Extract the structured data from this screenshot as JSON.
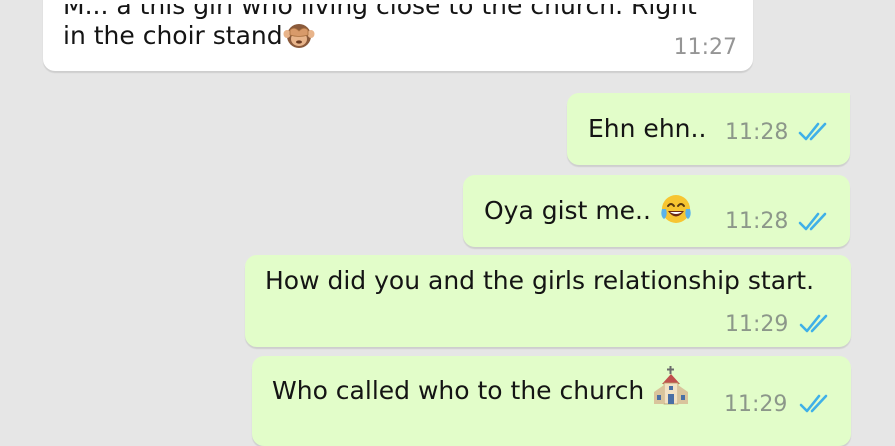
{
  "chat": {
    "messages": [
      {
        "direction": "incoming",
        "lines": [
          "M... a this girl who living close to the church. Right",
          "in the choir stand"
        ],
        "emoji": "see-no-evil-monkey",
        "time": "11:27"
      },
      {
        "direction": "outgoing",
        "text": "Ehn ehn..",
        "time": "11:28",
        "status": "read"
      },
      {
        "direction": "outgoing",
        "text": "Oya gist me..",
        "emoji": "face-with-tears-of-joy",
        "time": "11:28",
        "status": "read"
      },
      {
        "direction": "outgoing",
        "text": "How did you and the girls relationship start.",
        "time": "11:29",
        "status": "read"
      },
      {
        "direction": "outgoing",
        "text": "Who called who to the church",
        "emoji": "church",
        "time": "11:29",
        "status": "read"
      }
    ]
  },
  "colors": {
    "background": "#e6e6e6",
    "incoming_bubble": "#ffffff",
    "outgoing_bubble": "#e2fdc9",
    "read_ticks": "#3fb0e8",
    "timestamp": "#8c978a"
  }
}
